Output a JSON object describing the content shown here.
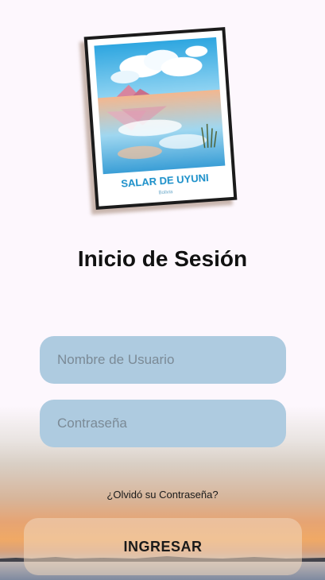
{
  "poster": {
    "title": "SALAR DE UYUNI",
    "subtitle": "Bolivia"
  },
  "login": {
    "title": "Inicio de Sesión",
    "username_placeholder": "Nombre de Usuario",
    "password_placeholder": "Contraseña",
    "forgot_label": "¿Olvidó su Contraseña?",
    "submit_label": "INGRESAR"
  },
  "colors": {
    "field_background": "#aecbe0",
    "page_background": "#fdf7fd",
    "poster_title": "#1a8fc9"
  }
}
